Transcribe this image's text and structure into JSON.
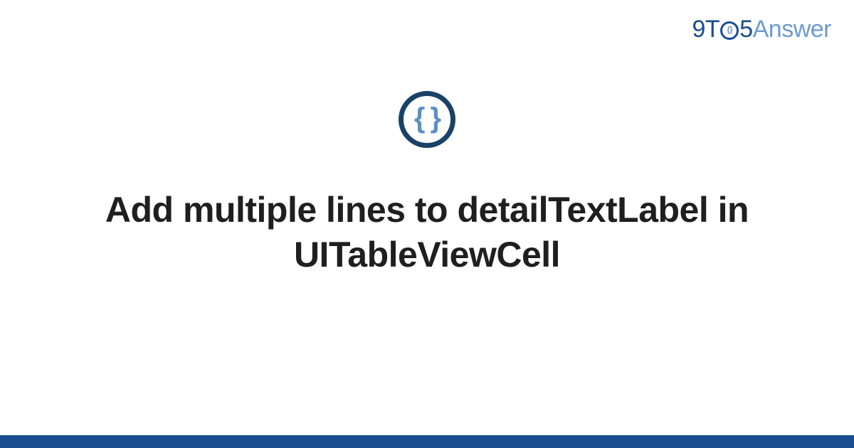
{
  "logo": {
    "part1": "9T",
    "part_o_inner": "{}",
    "part2": "5",
    "part3": "Answer"
  },
  "icon": {
    "name": "code-braces-icon",
    "glyph": "{ }"
  },
  "title": "Add multiple lines to detailTextLabel in UITableViewCell",
  "colors": {
    "brand_dark": "#1a4d8f",
    "brand_light": "#6b9bd1",
    "icon_ring": "#1a4268",
    "icon_fill": "#5a8fc7",
    "text": "#1f1f1f"
  }
}
